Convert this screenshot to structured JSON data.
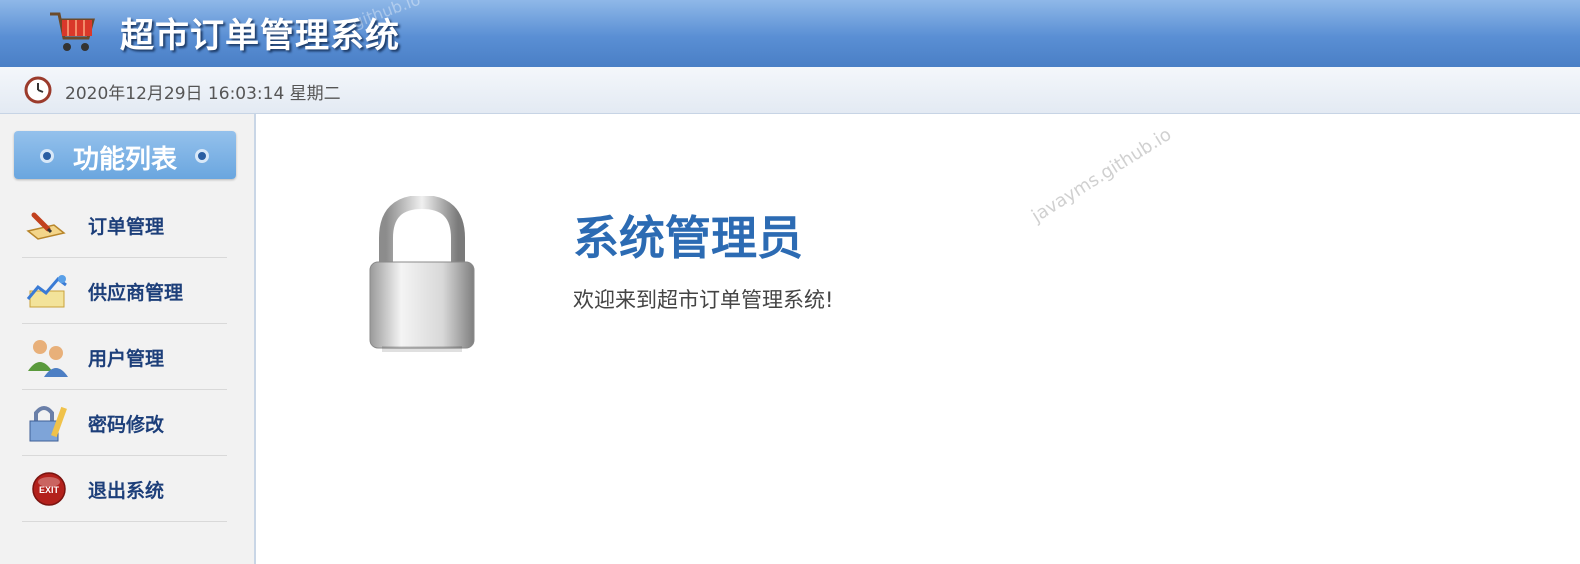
{
  "header": {
    "title": "超市订单管理系统",
    "icon": "shopping-cart-icon",
    "watermark": "github.io"
  },
  "timebar": {
    "icon": "clock-icon",
    "datetime": "2020年12月29日 16:03:14 星期二"
  },
  "sidebar": {
    "title": "功能列表",
    "items": [
      {
        "label": "订单管理",
        "icon": "order-pencil-icon"
      },
      {
        "label": "供应商管理",
        "icon": "supplier-chart-icon"
      },
      {
        "label": "用户管理",
        "icon": "users-icon"
      },
      {
        "label": "密码修改",
        "icon": "lock-password-icon"
      },
      {
        "label": "退出系统",
        "icon": "exit-icon"
      }
    ]
  },
  "main": {
    "icon": "padlock-icon",
    "role": "系统管理员",
    "welcome": "欢迎来到超市订单管理系统!",
    "watermark": "javayms.github.io"
  },
  "colors": {
    "header": "#5a8fd4",
    "title_blue": "#2c6bb3",
    "menu_text": "#1d3f7a"
  }
}
